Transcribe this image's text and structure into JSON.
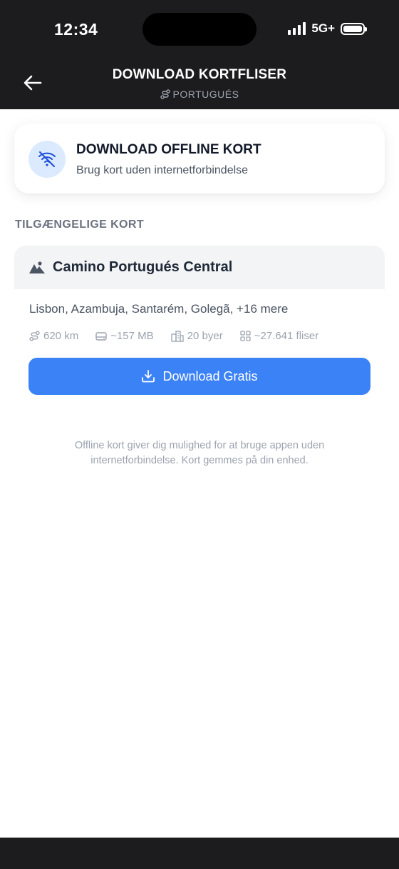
{
  "status_bar": {
    "time": "12:34",
    "network": "5G+",
    "signal_bars": 4,
    "battery_level": 1.0
  },
  "nav": {
    "title": "DOWNLOAD KORTFLISER",
    "subtitle": "PORTUGUÉS",
    "back_icon": "arrow-left-icon",
    "subtitle_icon": "route-icon"
  },
  "offline_card": {
    "icon": "wifi-off-icon",
    "title": "DOWNLOAD OFFLINE KORT",
    "subtitle": "Brug kort uden internetforbindelse"
  },
  "section_label": "TILGÆNGELIGE KORT",
  "maps": [
    {
      "icon": "mountain-image-icon",
      "name": "Camino Portugués Central",
      "cities": "Lisbon, Azambuja, Santarém, Golegã, +16 mere",
      "stats": {
        "distance": "620 km",
        "size": "~157 MB",
        "cities_count": "20 byer",
        "tiles": "~27.641 fliser"
      },
      "button_label": "Download Gratis"
    }
  ],
  "footer_note": "Offline kort giver dig mulighed for at bruge appen uden internetforbindelse. Kort gemmes på din enhed.",
  "colors": {
    "accent": "#3b82f6",
    "header_bg": "#1c1c1e",
    "icon_circle": "#dbeafe"
  }
}
